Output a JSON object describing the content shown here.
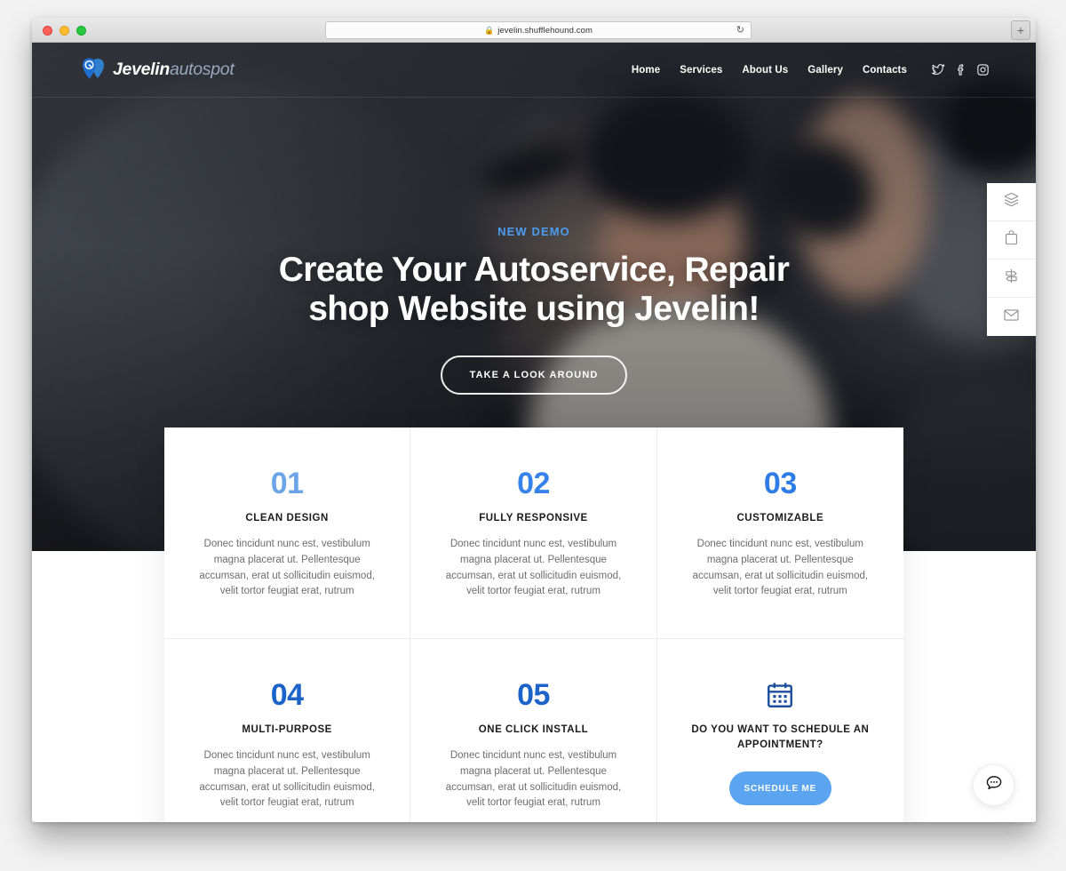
{
  "browser": {
    "url": "jevelin.shufflehound.com",
    "lock_icon": "lock-icon",
    "reload_icon": "reload-icon",
    "newtab_label": "+",
    "traffic_lights": [
      "close",
      "minimize",
      "zoom"
    ]
  },
  "site": {
    "logo": {
      "primary": "Jevelin",
      "secondary": "autospot",
      "icon": "map-pin-icon"
    },
    "nav": [
      {
        "label": "Home"
      },
      {
        "label": "Services"
      },
      {
        "label": "About Us"
      },
      {
        "label": "Gallery"
      },
      {
        "label": "Contacts"
      }
    ],
    "socials": [
      {
        "name": "twitter-icon"
      },
      {
        "name": "facebook-icon"
      },
      {
        "name": "instagram-icon"
      }
    ],
    "hero": {
      "eyebrow": "NEW DEMO",
      "title_line1": "Create Your Autoservice, Repair",
      "title_line2": "shop Website using Jevelin!",
      "button": "TAKE A LOOK AROUND"
    },
    "dock": [
      {
        "name": "layers-icon"
      },
      {
        "name": "shopping-bag-icon"
      },
      {
        "name": "signpost-icon"
      },
      {
        "name": "envelope-icon"
      }
    ],
    "features": [
      {
        "number": "01",
        "color": "#6ba5e7",
        "title": "CLEAN DESIGN",
        "body": "Donec tincidunt nunc est, vestibulum magna placerat ut. Pellentesque accumsan, erat ut sollicitudin euismod, velit tortor feugiat erat, rutrum"
      },
      {
        "number": "02",
        "color": "#3583ea",
        "title": "FULLY RESPONSIVE",
        "body": "Donec tincidunt nunc est, vestibulum magna placerat ut. Pellentesque accumsan, erat ut sollicitudin euismod, velit tortor feugiat erat, rutrum"
      },
      {
        "number": "03",
        "color": "#2d7ce8",
        "title": "CUSTOMIZABLE",
        "body": "Donec tincidunt nunc est, vestibulum magna placerat ut. Pellentesque accumsan, erat ut sollicitudin euismod, velit tortor feugiat erat, rutrum"
      },
      {
        "number": "04",
        "color": "#1b63c9",
        "title": "MULTI-PURPOSE",
        "body": "Donec tincidunt nunc est, vestibulum magna placerat ut. Pellentesque accumsan, erat ut sollicitudin euismod, velit tortor feugiat erat, rutrum"
      },
      {
        "number": "05",
        "color": "#1b63c9",
        "title": "ONE CLICK INSTALL",
        "body": "Donec tincidunt nunc est, vestibulum magna placerat ut. Pellentesque accumsan, erat ut sollicitudin euismod, velit tortor feugiat erat, rutrum"
      }
    ],
    "appointment": {
      "icon": "calendar-icon",
      "icon_color": "#1b4f9e",
      "title": "DO YOU WANT TO SCHEDULE AN APPOINTMENT?",
      "button": "SCHEDULE ME",
      "button_color": "#5ba4f0"
    },
    "chat": {
      "icon": "chat-bubble-icon"
    }
  }
}
